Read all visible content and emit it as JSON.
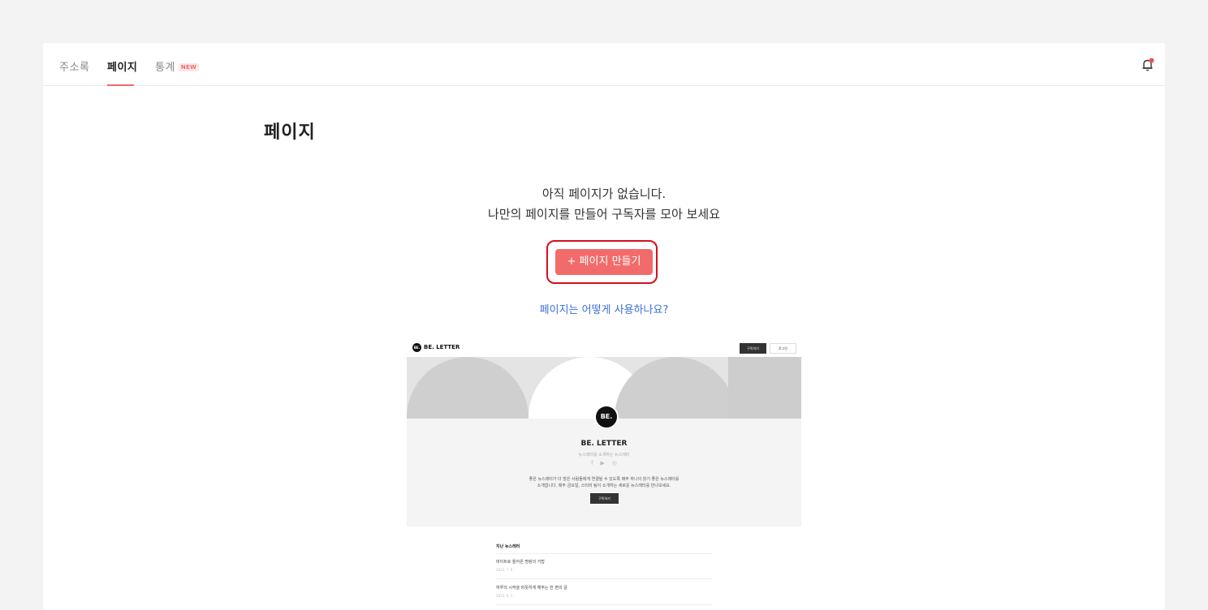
{
  "nav": {
    "tabs": [
      {
        "label": "주소록",
        "active": false
      },
      {
        "label": "페이지",
        "active": true
      },
      {
        "label": "통계",
        "active": false,
        "badge": "NEW"
      }
    ],
    "notification_icon": "bell-icon"
  },
  "page": {
    "title": "페이지",
    "empty_line1": "아직 페이지가 없습니다.",
    "empty_line2": "나만의 페이지를 만들어 구독자를 모아 보세요",
    "create_button": "+ 페이지 만들기",
    "howto_link": "페이지는 어떻게 사용하나요?"
  },
  "preview": {
    "logo_text": "BE.",
    "brand_name": "BE. LETTER",
    "subscribe_btn": "구독하기",
    "login_btn": "로그인",
    "profile_title": "BE. LETTER",
    "tagline": "뉴스레터를 소개하는 뉴스레터",
    "social_icons": [
      "facebook-icon",
      "youtube-icon",
      "instagram-icon"
    ],
    "desc_line1": "좋은 뉴스레터가 더 많은 사람들에게 연결될 수 있도록 매주 하나의 읽기 좋은 뉴스레터를",
    "desc_line2": "소개합니다. 매주 금요일, 스티비 팀이 소개하는 새로운 뉴스레터를 만나보세요.",
    "cta": "구독하기",
    "past_title": "지난 뉴스레터",
    "items": [
      {
        "title": "바이트로 들어온 명랑의 거탑",
        "date": "2023. 7. 6."
      },
      {
        "title": "하루의 시작을 따뜻하게 해주는 한 편의 글",
        "date": "2023. 6. 1."
      }
    ]
  },
  "colors": {
    "accent": "#f26b6b",
    "highlight_border": "#d40f1e",
    "link": "#3d6fd8"
  }
}
